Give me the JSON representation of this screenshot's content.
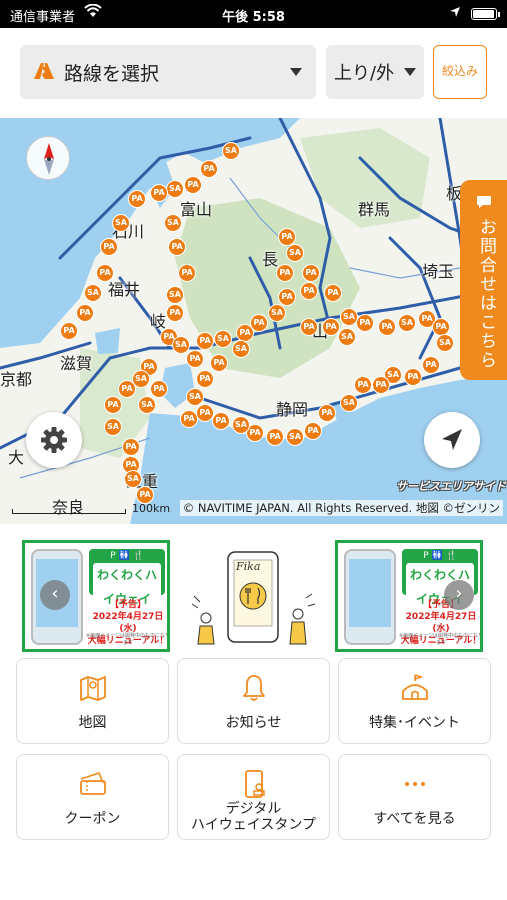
{
  "status_bar": {
    "carrier": "通信事業者",
    "time": "午後 5:58",
    "battery_level": 0.95
  },
  "toolbar": {
    "route_select_label": "路線を選択",
    "direction_label": "上り/外",
    "filter_label": "絞込み"
  },
  "map": {
    "place_names": [
      "富山",
      "群馬",
      "石川",
      "福井",
      "長",
      "埼玉",
      "岐",
      "滋賀",
      "山",
      "京都",
      "静岡",
      "大",
      "三重",
      "奈良",
      "板"
    ],
    "contact_tab_label": "お問合せはこちら",
    "scale_label": "100km",
    "copyright": "© NAVITIME JAPAN. All Rights Reserved. 地図 ©ゼンリン",
    "logo_text": "サービスエリアサイド",
    "pin_labels": [
      "PA",
      "SA"
    ]
  },
  "banners": [
    {
      "badge_top": "P 🚻 🍴",
      "badge_title": "わくわくハイウェイ",
      "notice_line1": "【予告】",
      "notice_line2": "2022年4月27日(水)",
      "notice_line3": "大幅リニューアル！",
      "small_print": "※画面イメージは開発中のものになります"
    },
    {
      "badge_top": "P 🚻 🍴",
      "badge_title": "わくわくハイウェイ",
      "notice_line1": "【予告】",
      "notice_line2": "2022年4月27日(水)",
      "notice_line3": "大幅リニューアル！",
      "small_print": "※画面イメージは開発中のものになります"
    }
  ],
  "fika_word": "Fika",
  "menu": [
    {
      "label": "地図",
      "icon": "map-icon"
    },
    {
      "label": "お知らせ",
      "icon": "bell-icon"
    },
    {
      "label": "特集･イベント",
      "icon": "tent-icon"
    },
    {
      "label": "クーポン",
      "icon": "coupon-icon"
    },
    {
      "label": "デジタル",
      "label2": "ハイウェイスタンプ",
      "icon": "stamp-icon"
    },
    {
      "label": "すべてを見る",
      "icon": "more-icon"
    }
  ],
  "colors": {
    "accent": "#f08a1e",
    "pin": "#ef7c12",
    "banner_border": "#22a546",
    "sea": "#9fd0ef",
    "land": "#ffffff",
    "road": "#2f5da8"
  }
}
